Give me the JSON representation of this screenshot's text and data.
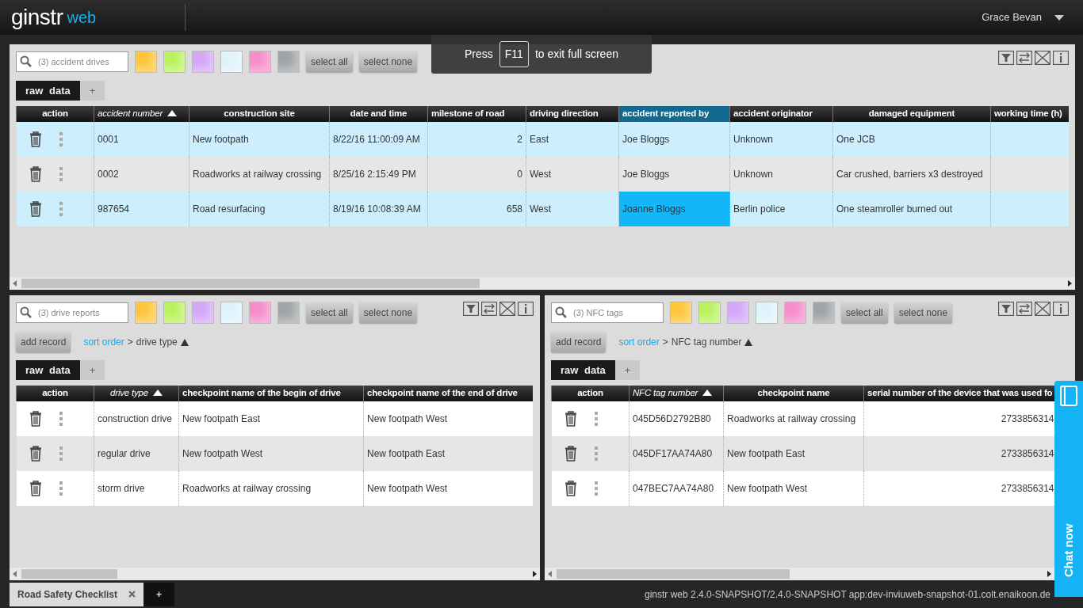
{
  "header": {
    "logo_main": "ginstr",
    "logo_sub": "web",
    "user": "Grace Bevan"
  },
  "fullscreen_notice": {
    "before": "Press",
    "key": "F11",
    "after": "to exit full screen"
  },
  "panels": [
    {
      "search": {
        "placeholder": "(3) accident drives"
      },
      "swatches": [
        {
          "color": "#ffc53a"
        },
        {
          "color": "#b9f25e"
        },
        {
          "color": "#d3a6f7"
        },
        {
          "color": "#dff3fc"
        },
        {
          "color": "#f68cc9"
        },
        {
          "color": "#9fa4a7"
        }
      ],
      "buttons": [
        "select all",
        "select none"
      ],
      "view_tabs": [
        {
          "label": "raw data",
          "selected": true
        },
        {
          "label": "+",
          "selected": false
        }
      ],
      "columns": [
        {
          "label": "action",
          "kind": "actions",
          "sorted": false,
          "focused": false
        },
        {
          "label": "accident number",
          "kind": "data",
          "sorted": true,
          "focused": false
        },
        {
          "label": "construction site",
          "kind": "data",
          "sorted": false,
          "focused": false
        },
        {
          "label": "date and time",
          "kind": "data",
          "sorted": false,
          "focused": false
        },
        {
          "label": "milestone of road",
          "kind": "number",
          "sorted": false,
          "focused": false
        },
        {
          "label": "driving direction",
          "kind": "data",
          "sorted": false,
          "focused": false
        },
        {
          "label": "accident reported by",
          "kind": "data",
          "sorted": false,
          "focused": true
        },
        {
          "label": "accident originator",
          "kind": "data",
          "sorted": false,
          "focused": false
        },
        {
          "label": "damaged equipment",
          "kind": "data",
          "sorted": false,
          "focused": false
        },
        {
          "label": "working time (h)",
          "kind": "number",
          "sorted": false,
          "focused": false
        }
      ],
      "rows": [
        {
          "selected": true,
          "focused": false,
          "cells": [
            "",
            "0001",
            "New footpath",
            "8/22/16 11:00:09 AM",
            "2",
            "East",
            "Joe Bloggs",
            "Unknown",
            "One JCB",
            ""
          ]
        },
        {
          "selected": false,
          "focused": false,
          "cells": [
            "",
            "0002",
            "Roadworks at railway crossing",
            "8/25/16 2:15:49 PM",
            "0",
            "West",
            "Joe Bloggs",
            "Unknown",
            "Car crushed, barriers x3 destroyed",
            ""
          ]
        },
        {
          "selected": true,
          "focused": true,
          "cells": [
            "",
            "987654",
            "Road resurfacing",
            "8/19/16 10:08:39 AM",
            "658",
            "West",
            "Joanne Bloggs",
            "Berlin police",
            "One steamroller burned out",
            ""
          ]
        }
      ]
    },
    {
      "search": {
        "placeholder": "(3) drive reports"
      },
      "swatches": [
        {
          "color": "#ffc53a"
        },
        {
          "color": "#b9f25e"
        },
        {
          "color": "#d3a6f7"
        },
        {
          "color": "#dff3fc"
        },
        {
          "color": "#f68cc9"
        },
        {
          "color": "#9fa4a7"
        }
      ],
      "buttons": [
        "select all",
        "select none"
      ],
      "add_record": "add record",
      "sort": {
        "link": "sort order",
        "separator": ">",
        "field": "drive type"
      },
      "view_tabs": [
        {
          "label": "raw data",
          "selected": true
        },
        {
          "label": "+",
          "selected": false
        }
      ],
      "columns": [
        {
          "label": "action",
          "kind": "actions",
          "sorted": false,
          "focused": false
        },
        {
          "label": "drive type",
          "kind": "data",
          "sorted": true,
          "focused": false
        },
        {
          "label": "checkpoint name of the begin of drive",
          "kind": "data",
          "sorted": false,
          "focused": false
        },
        {
          "label": "checkpoint name of the end of drive",
          "kind": "data",
          "sorted": false,
          "focused": false
        }
      ],
      "rows": [
        {
          "selected": false,
          "focused": false,
          "cells": [
            "",
            "construction drive",
            "New footpath East",
            "New footpath West"
          ]
        },
        {
          "selected": false,
          "focused": false,
          "cells": [
            "",
            "regular drive",
            "New footpath West",
            "New footpath East"
          ]
        },
        {
          "selected": false,
          "focused": false,
          "cells": [
            "",
            "storm drive",
            "Roadworks at railway crossing",
            "New footpath West"
          ]
        }
      ]
    },
    {
      "search": {
        "placeholder": "(3) NFC tags"
      },
      "swatches": [
        {
          "color": "#ffc53a"
        },
        {
          "color": "#b9f25e"
        },
        {
          "color": "#d3a6f7"
        },
        {
          "color": "#dff3fc"
        },
        {
          "color": "#f68cc9"
        },
        {
          "color": "#9fa4a7"
        }
      ],
      "buttons": [
        "select all",
        "select none"
      ],
      "add_record": "add record",
      "sort": {
        "link": "sort order",
        "separator": ">",
        "field": "NFC tag number"
      },
      "view_tabs": [
        {
          "label": "raw data",
          "selected": true
        },
        {
          "label": "+",
          "selected": false
        }
      ],
      "columns": [
        {
          "label": "action",
          "kind": "actions",
          "sorted": false,
          "focused": false
        },
        {
          "label": "NFC tag number",
          "kind": "data",
          "sorted": true,
          "focused": false
        },
        {
          "label": "checkpoint name",
          "kind": "data",
          "sorted": false,
          "focused": false
        },
        {
          "label": "serial number of the device that was used fo",
          "kind": "number",
          "sorted": false,
          "focused": false
        }
      ],
      "rows": [
        {
          "selected": false,
          "focused": false,
          "cells": [
            "",
            "045D56D2792B80",
            "Roadworks at railway crossing",
            "2733856314"
          ]
        },
        {
          "selected": false,
          "focused": false,
          "cells": [
            "",
            "045DF17AA74A80",
            "New footpath East",
            "2733856314"
          ]
        },
        {
          "selected": false,
          "focused": false,
          "cells": [
            "",
            "047BEC7AA74A80",
            "New footpath West",
            "2733856314"
          ]
        }
      ]
    }
  ],
  "footer": {
    "tabs": [
      {
        "label": "Road Safety Checklist",
        "selected": true,
        "closable": true
      },
      {
        "label": "+",
        "selected": false,
        "closable": false
      }
    ],
    "version": "ginstr web 2.4.0-SNAPSHOT/2.4.0-SNAPSHOT app:dev-inviuweb-snapshot-01.colt.enaikoon.de"
  },
  "chat": {
    "label": "Chat now"
  }
}
